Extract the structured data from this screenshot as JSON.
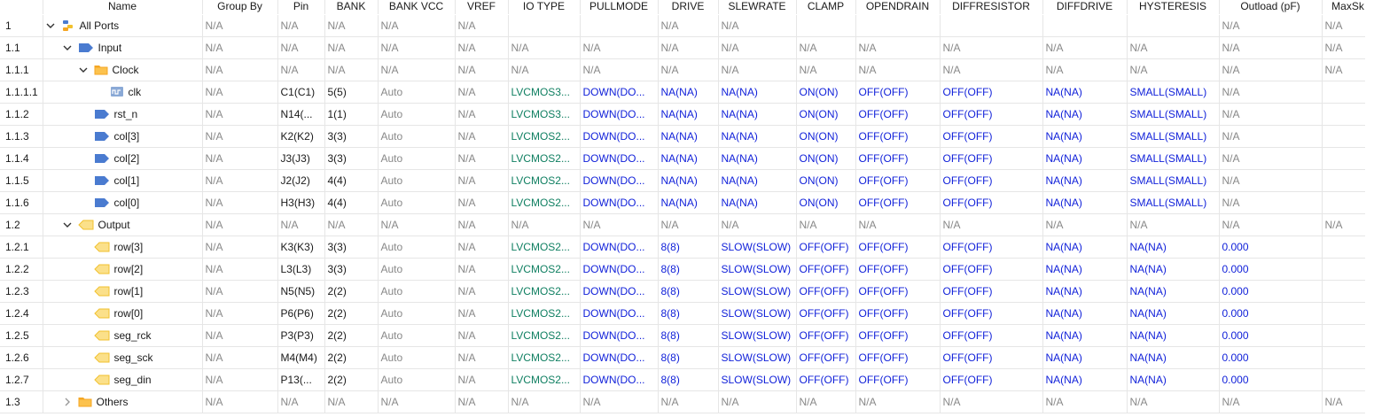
{
  "columns": [
    "Name",
    "Group By",
    "Pin",
    "BANK",
    "BANK VCC",
    "VREF",
    "IO TYPE",
    "PULLMODE",
    "DRIVE",
    "SLEWRATE",
    "CLAMP",
    "OPENDRAIN",
    "DIFFRESISTOR",
    "DIFFDRIVE",
    "HYSTERESIS",
    "Outload (pF)",
    "MaxSk"
  ],
  "rows": [
    {
      "id": "1",
      "name": "All Ports",
      "icon": "ports-group-icon",
      "indent": 0,
      "chevron": "down",
      "cells": [
        "N/A",
        "N/A",
        "N/A",
        "N/A",
        "N/A",
        "",
        "",
        "N/A",
        "N/A",
        "",
        "",
        "",
        "",
        "",
        "N/A",
        "N/A"
      ]
    },
    {
      "id": "1.1",
      "name": "Input",
      "icon": "input-port-icon",
      "indent": 1,
      "chevron": "down",
      "cells": [
        "N/A",
        "N/A",
        "N/A",
        "N/A",
        "N/A",
        "N/A",
        "N/A",
        "N/A",
        "N/A",
        "N/A",
        "N/A",
        "N/A",
        "N/A",
        "N/A",
        "N/A",
        "N/A"
      ]
    },
    {
      "id": "1.1.1",
      "name": "Clock",
      "icon": "folder-icon",
      "indent": 2,
      "chevron": "down",
      "cells": [
        "N/A",
        "N/A",
        "N/A",
        "N/A",
        "N/A",
        "N/A",
        "N/A",
        "N/A",
        "N/A",
        "N/A",
        "N/A",
        "N/A",
        "N/A",
        "N/A",
        "N/A",
        "N/A"
      ]
    },
    {
      "id": "1.1.1.1",
      "name": "clk",
      "icon": "clock-port-icon",
      "indent": 3,
      "chevron": "none",
      "cells": [
        "N/A",
        "C1(C1)",
        "5(5)",
        "Auto",
        "N/A",
        "LVCMOS3...",
        "DOWN(DO...",
        "NA(NA)",
        "NA(NA)",
        "ON(ON)",
        "OFF(OFF)",
        "OFF(OFF)",
        "NA(NA)",
        "SMALL(SMALL)",
        "N/A",
        ""
      ]
    },
    {
      "id": "1.1.2",
      "name": "rst_n",
      "icon": "input-port-icon",
      "indent": 3,
      "chevron": "none",
      "cells": [
        "N/A",
        "N14(...",
        "1(1)",
        "Auto",
        "N/A",
        "LVCMOS3...",
        "DOWN(DO...",
        "NA(NA)",
        "NA(NA)",
        "ON(ON)",
        "OFF(OFF)",
        "OFF(OFF)",
        "NA(NA)",
        "SMALL(SMALL)",
        "N/A",
        ""
      ]
    },
    {
      "id": "1.1.3",
      "name": "col[3]",
      "icon": "input-port-icon",
      "indent": 3,
      "chevron": "none",
      "cells": [
        "N/A",
        "K2(K2)",
        "3(3)",
        "Auto",
        "N/A",
        "LVCMOS2...",
        "DOWN(DO...",
        "NA(NA)",
        "NA(NA)",
        "ON(ON)",
        "OFF(OFF)",
        "OFF(OFF)",
        "NA(NA)",
        "SMALL(SMALL)",
        "N/A",
        ""
      ]
    },
    {
      "id": "1.1.4",
      "name": "col[2]",
      "icon": "input-port-icon",
      "indent": 3,
      "chevron": "none",
      "cells": [
        "N/A",
        "J3(J3)",
        "3(3)",
        "Auto",
        "N/A",
        "LVCMOS2...",
        "DOWN(DO...",
        "NA(NA)",
        "NA(NA)",
        "ON(ON)",
        "OFF(OFF)",
        "OFF(OFF)",
        "NA(NA)",
        "SMALL(SMALL)",
        "N/A",
        ""
      ]
    },
    {
      "id": "1.1.5",
      "name": "col[1]",
      "icon": "input-port-icon",
      "indent": 3,
      "chevron": "none",
      "cells": [
        "N/A",
        "J2(J2)",
        "4(4)",
        "Auto",
        "N/A",
        "LVCMOS2...",
        "DOWN(DO...",
        "NA(NA)",
        "NA(NA)",
        "ON(ON)",
        "OFF(OFF)",
        "OFF(OFF)",
        "NA(NA)",
        "SMALL(SMALL)",
        "N/A",
        ""
      ]
    },
    {
      "id": "1.1.6",
      "name": "col[0]",
      "icon": "input-port-icon",
      "indent": 3,
      "chevron": "none",
      "cells": [
        "N/A",
        "H3(H3)",
        "4(4)",
        "Auto",
        "N/A",
        "LVCMOS2...",
        "DOWN(DO...",
        "NA(NA)",
        "NA(NA)",
        "ON(ON)",
        "OFF(OFF)",
        "OFF(OFF)",
        "NA(NA)",
        "SMALL(SMALL)",
        "N/A",
        ""
      ]
    },
    {
      "id": "1.2",
      "name": "Output",
      "icon": "output-port-icon",
      "indent": 1,
      "chevron": "down",
      "cells": [
        "N/A",
        "N/A",
        "N/A",
        "N/A",
        "N/A",
        "N/A",
        "N/A",
        "N/A",
        "N/A",
        "N/A",
        "N/A",
        "N/A",
        "N/A",
        "N/A",
        "N/A",
        "N/A"
      ]
    },
    {
      "id": "1.2.1",
      "name": "row[3]",
      "icon": "output-port-icon",
      "indent": 3,
      "chevron": "none",
      "cells": [
        "N/A",
        "K3(K3)",
        "3(3)",
        "Auto",
        "N/A",
        "LVCMOS2...",
        "DOWN(DO...",
        "8(8)",
        "SLOW(SLOW)",
        "OFF(OFF)",
        "OFF(OFF)",
        "OFF(OFF)",
        "NA(NA)",
        "NA(NA)",
        "0.000",
        ""
      ]
    },
    {
      "id": "1.2.2",
      "name": "row[2]",
      "icon": "output-port-icon",
      "indent": 3,
      "chevron": "none",
      "cells": [
        "N/A",
        "L3(L3)",
        "3(3)",
        "Auto",
        "N/A",
        "LVCMOS2...",
        "DOWN(DO...",
        "8(8)",
        "SLOW(SLOW)",
        "OFF(OFF)",
        "OFF(OFF)",
        "OFF(OFF)",
        "NA(NA)",
        "NA(NA)",
        "0.000",
        ""
      ]
    },
    {
      "id": "1.2.3",
      "name": "row[1]",
      "icon": "output-port-icon",
      "indent": 3,
      "chevron": "none",
      "cells": [
        "N/A",
        "N5(N5)",
        "2(2)",
        "Auto",
        "N/A",
        "LVCMOS2...",
        "DOWN(DO...",
        "8(8)",
        "SLOW(SLOW)",
        "OFF(OFF)",
        "OFF(OFF)",
        "OFF(OFF)",
        "NA(NA)",
        "NA(NA)",
        "0.000",
        ""
      ]
    },
    {
      "id": "1.2.4",
      "name": "row[0]",
      "icon": "output-port-icon",
      "indent": 3,
      "chevron": "none",
      "cells": [
        "N/A",
        "P6(P6)",
        "2(2)",
        "Auto",
        "N/A",
        "LVCMOS2...",
        "DOWN(DO...",
        "8(8)",
        "SLOW(SLOW)",
        "OFF(OFF)",
        "OFF(OFF)",
        "OFF(OFF)",
        "NA(NA)",
        "NA(NA)",
        "0.000",
        ""
      ]
    },
    {
      "id": "1.2.5",
      "name": "seg_rck",
      "icon": "output-port-icon",
      "indent": 3,
      "chevron": "none",
      "cells": [
        "N/A",
        "P3(P3)",
        "2(2)",
        "Auto",
        "N/A",
        "LVCMOS2...",
        "DOWN(DO...",
        "8(8)",
        "SLOW(SLOW)",
        "OFF(OFF)",
        "OFF(OFF)",
        "OFF(OFF)",
        "NA(NA)",
        "NA(NA)",
        "0.000",
        ""
      ]
    },
    {
      "id": "1.2.6",
      "name": "seg_sck",
      "icon": "output-port-icon",
      "indent": 3,
      "chevron": "none",
      "cells": [
        "N/A",
        "M4(M4)",
        "2(2)",
        "Auto",
        "N/A",
        "LVCMOS2...",
        "DOWN(DO...",
        "8(8)",
        "SLOW(SLOW)",
        "OFF(OFF)",
        "OFF(OFF)",
        "OFF(OFF)",
        "NA(NA)",
        "NA(NA)",
        "0.000",
        ""
      ]
    },
    {
      "id": "1.2.7",
      "name": "seg_din",
      "icon": "output-port-icon",
      "indent": 3,
      "chevron": "none",
      "cells": [
        "N/A",
        "P13(...",
        "2(2)",
        "Auto",
        "N/A",
        "LVCMOS2...",
        "DOWN(DO...",
        "8(8)",
        "SLOW(SLOW)",
        "OFF(OFF)",
        "OFF(OFF)",
        "OFF(OFF)",
        "NA(NA)",
        "NA(NA)",
        "0.000",
        ""
      ]
    },
    {
      "id": "1.3",
      "name": "Others",
      "icon": "folder-icon",
      "indent": 1,
      "chevron": "right",
      "cells": [
        "N/A",
        "N/A",
        "N/A",
        "N/A",
        "N/A",
        "N/A",
        "N/A",
        "N/A",
        "N/A",
        "N/A",
        "N/A",
        "N/A",
        "N/A",
        "N/A",
        "N/A",
        "N/A"
      ]
    }
  ],
  "colors": {
    "na_gray": "#888888",
    "iotype_green": "#0f7f61",
    "value_blue": "#0f1fd9",
    "chevron_blue": "#1e88e5",
    "port_blue": "#4a7bd0",
    "output_yellow": "#f2c12e",
    "folder_orange": "#f5a623",
    "grid_line": "#e6e6e6"
  }
}
